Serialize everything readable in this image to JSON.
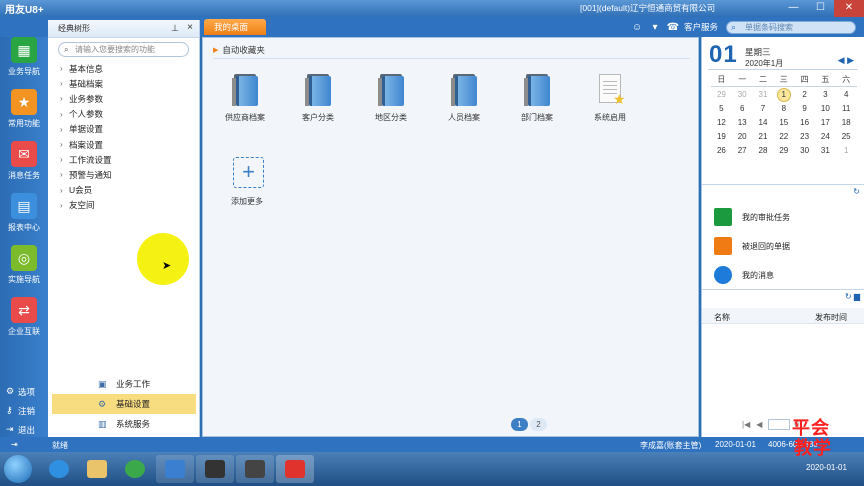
{
  "window": {
    "app_logo": "用友U8+",
    "title": "[001](default)辽宁恒通商贸有限公司",
    "minimize": "—",
    "maximize": "☐",
    "close": "✕"
  },
  "toolbar": {
    "active_tab": "我的桌面",
    "service_label": "客户服务",
    "search_placeholder": "单据条码搜索"
  },
  "left_nav": {
    "items": [
      {
        "label": "业务导航",
        "icon": "grid-icon",
        "color": "#2aa544"
      },
      {
        "label": "常用功能",
        "icon": "star-icon",
        "color": "#f39321"
      },
      {
        "label": "消息任务",
        "icon": "envelope-icon",
        "color": "#e94a4a"
      },
      {
        "label": "报表中心",
        "icon": "report-icon",
        "color": "#3c8fdc"
      },
      {
        "label": "实施导航",
        "icon": "compass-icon",
        "color": "#7bbb2c"
      },
      {
        "label": "企业互联",
        "icon": "connect-icon",
        "color": "#e94a4a"
      }
    ],
    "bottom": [
      {
        "label": "选项",
        "icon": "gear-icon"
      },
      {
        "label": "注销",
        "icon": "key-icon"
      },
      {
        "label": "退出",
        "icon": "exit-icon"
      }
    ]
  },
  "tree": {
    "title": "经典树形",
    "search_placeholder": "请输入您要搜索的功能",
    "items": [
      "基本信息",
      "基础档案",
      "业务参数",
      "个人参数",
      "单据设置",
      "档案设置",
      "工作流设置",
      "预警与通知",
      "U会员",
      "友空间"
    ],
    "bottom_tabs": [
      {
        "label": "业务工作",
        "active": false
      },
      {
        "label": "基础设置",
        "active": true
      },
      {
        "label": "系统服务",
        "active": false
      }
    ]
  },
  "desktop": {
    "section_title": "自动收藏夹",
    "apps": [
      "供应商档案",
      "客户分类",
      "地区分类",
      "人员档案",
      "部门档案",
      "系统启用"
    ],
    "add_more": "添加更多",
    "pages": [
      "1",
      "2"
    ]
  },
  "calendar": {
    "day": "01",
    "weekday": "星期三",
    "month": "2020年1月",
    "headers": [
      "日",
      "一",
      "二",
      "三",
      "四",
      "五",
      "六"
    ],
    "weeks": [
      [
        "29",
        "30",
        "31",
        "1",
        "2",
        "3",
        "4"
      ],
      [
        "5",
        "6",
        "7",
        "8",
        "9",
        "10",
        "11"
      ],
      [
        "12",
        "13",
        "14",
        "15",
        "16",
        "17",
        "18"
      ],
      [
        "19",
        "20",
        "21",
        "22",
        "23",
        "24",
        "25"
      ],
      [
        "26",
        "27",
        "28",
        "29",
        "30",
        "31",
        "1"
      ]
    ]
  },
  "tasks": [
    "我的审批任务",
    "被退回的单据",
    "我的消息"
  ],
  "messages": {
    "col_name": "名称",
    "col_time": "发布时间",
    "page_value": "0"
  },
  "status": {
    "ready": "就绪",
    "user": "李成嘉(账套主管)",
    "date": "2020-01-01",
    "phone": "4006-600-588"
  },
  "taskbar": {
    "clock": "2020-01-01"
  },
  "watermark": {
    "line1": "平会",
    "line2": "教学"
  }
}
